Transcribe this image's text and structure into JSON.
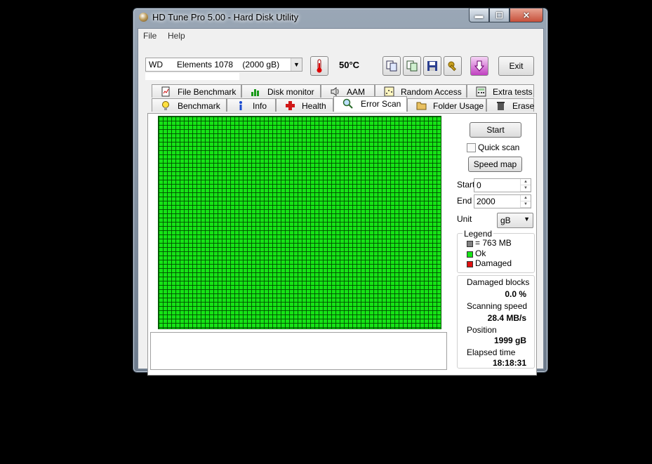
{
  "window": {
    "title": "HD Tune Pro 5.00 - Hard Disk Utility"
  },
  "menu": [
    {
      "label": "File"
    },
    {
      "label": "Help"
    }
  ],
  "toolbar": {
    "drive": "WD      Elements 1078    (2000 gB)",
    "temperature": "50°C",
    "exit_label": "Exit"
  },
  "tabs_top": [
    {
      "label": "File Benchmark"
    },
    {
      "label": "Disk monitor"
    },
    {
      "label": "AAM"
    },
    {
      "label": "Random Access"
    },
    {
      "label": "Extra tests"
    }
  ],
  "tabs_bottom": [
    {
      "label": "Benchmark"
    },
    {
      "label": "Info"
    },
    {
      "label": "Health"
    },
    {
      "label": "Error Scan"
    },
    {
      "label": "Folder Usage"
    },
    {
      "label": "Erase"
    }
  ],
  "active_tab": "Error Scan",
  "scan": {
    "start_button": "Start",
    "quick_scan_label": "Quick scan",
    "quick_scan_checked": false,
    "speed_map_button": "Speed map",
    "start_label": "Start",
    "start_value": "0",
    "end_label": "End",
    "end_value": "2000",
    "unit_label": "Unit",
    "unit_value": "gB"
  },
  "legend": {
    "title": "Legend",
    "items": [
      {
        "label": "= 763 MB",
        "color": "#808080"
      },
      {
        "label": "Ok",
        "color": "#16e316"
      },
      {
        "label": "Damaged",
        "color": "#e01010"
      }
    ]
  },
  "stats": {
    "damaged_blocks_label": "Damaged blocks",
    "damaged_blocks_value": "0.0 %",
    "scanning_speed_label": "Scanning speed",
    "scanning_speed_value": "28.4 MB/s",
    "position_label": "Position",
    "position_value": "1999 gB",
    "elapsed_label": "Elapsed time",
    "elapsed_value": "18:18:31"
  },
  "colors": {
    "ok_block": "#16e316",
    "damaged_block": "#e01010",
    "block_size": "#808080"
  }
}
